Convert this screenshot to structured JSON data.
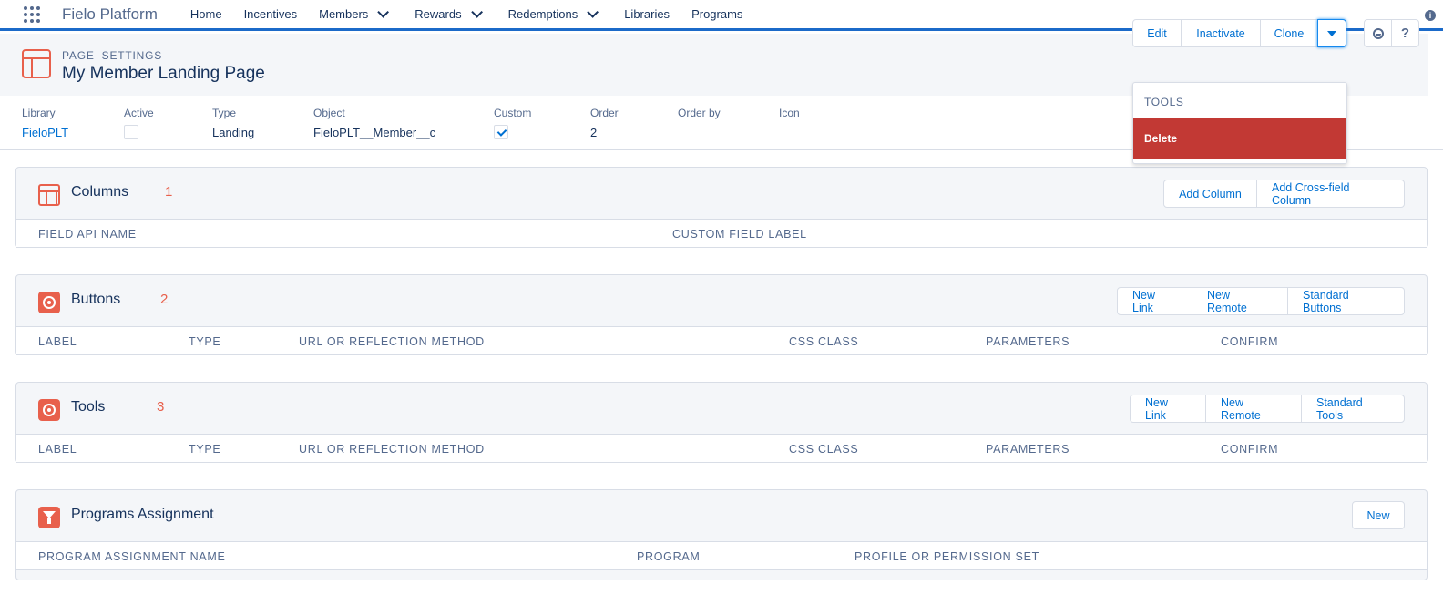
{
  "nav": {
    "app_name": "Fielo Platform",
    "items": [
      {
        "label": "Home",
        "has_menu": false
      },
      {
        "label": "Incentives",
        "has_menu": false
      },
      {
        "label": "Members",
        "has_menu": true
      },
      {
        "label": "Rewards",
        "has_menu": true
      },
      {
        "label": "Redemptions",
        "has_menu": true
      },
      {
        "label": "Libraries",
        "has_menu": false
      },
      {
        "label": "Programs",
        "has_menu": false
      }
    ]
  },
  "header": {
    "eyebrow_1": "PAGE",
    "eyebrow_2": "SETTINGS",
    "title": "My Member Landing Page",
    "actions": {
      "edit": "Edit",
      "inactivate": "Inactivate",
      "clone": "Clone"
    },
    "help_label": "?"
  },
  "fields": {
    "library": {
      "label": "Library",
      "value": "FieloPLT"
    },
    "active": {
      "label": "Active",
      "checked": false
    },
    "type": {
      "label": "Type",
      "value": "Landing"
    },
    "object": {
      "label": "Object",
      "value": "FieloPLT__Member__c"
    },
    "custom": {
      "label": "Custom",
      "checked": true
    },
    "order": {
      "label": "Order",
      "value": "2"
    },
    "order_by": {
      "label": "Order by",
      "value": ""
    },
    "icon": {
      "label": "Icon",
      "value": ""
    }
  },
  "dropdown": {
    "heading": "TOOLS",
    "delete": "Delete"
  },
  "sections": {
    "columns": {
      "title": "Columns",
      "number": "1",
      "buttons": {
        "add_column": "Add Column",
        "add_cross": "Add Cross-field Column"
      },
      "headers": [
        "FIELD API NAME",
        "CUSTOM FIELD LABEL"
      ]
    },
    "buttons": {
      "title": "Buttons",
      "number": "2",
      "buttons": {
        "new_link": "New Link",
        "new_remote": "New Remote",
        "standard": "Standard Buttons"
      },
      "headers": [
        "LABEL",
        "TYPE",
        "URL OR REFLECTION METHOD",
        "CSS CLASS",
        "PARAMETERS",
        "CONFIRM"
      ]
    },
    "tools": {
      "title": "Tools",
      "number": "3",
      "buttons": {
        "new_link": "New Link",
        "new_remote": "New Remote",
        "standard": "Standard Tools"
      },
      "headers": [
        "LABEL",
        "TYPE",
        "URL OR REFLECTION METHOD",
        "CSS CLASS",
        "PARAMETERS",
        "CONFIRM"
      ]
    },
    "programs": {
      "title": "Programs Assignment",
      "buttons": {
        "new": "New"
      },
      "headers": [
        "PROGRAM ASSIGNMENT NAME",
        "PROGRAM",
        "PROFILE OR PERMISSION SET"
      ]
    }
  },
  "colors": {
    "accent": "#e8604c",
    "brand_blue": "#0070d2",
    "delete_red": "#c23934"
  }
}
